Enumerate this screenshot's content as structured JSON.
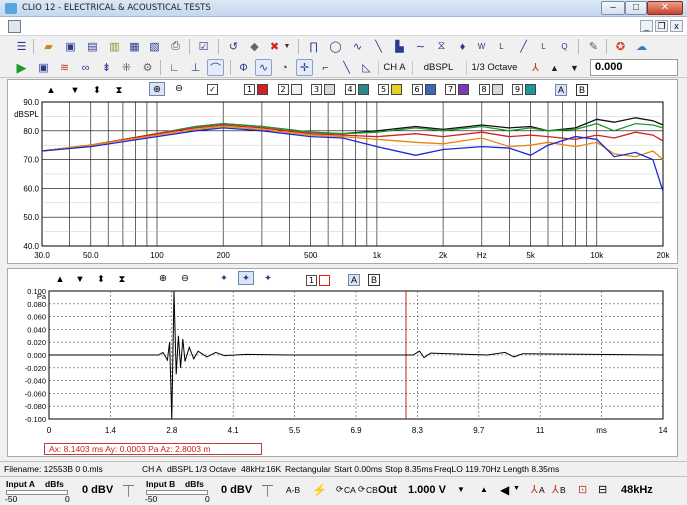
{
  "window": {
    "title": "CLIO 12 - ELECTRICAL & ACOUSTICAL TESTS",
    "controls": {
      "minimize": "–",
      "maximize": "□",
      "close": "✕"
    },
    "mdi_controls": {
      "minimize": "_",
      "restore": "❐",
      "close": "x"
    }
  },
  "toolbar2": {
    "channel": "CH A",
    "unit": "dBSPL",
    "smoothing": "1/3 Octave",
    "value": "0.000"
  },
  "freq_panel": {
    "y_unit": "dBSPL",
    "checkbox_labels": [
      "1",
      "2",
      "3",
      "4",
      "5",
      "6",
      "7",
      "8",
      "9"
    ],
    "ab_labels": [
      "A",
      "B"
    ]
  },
  "time_panel": {
    "y_unit": "Pa",
    "x_unit": "ms",
    "checkbox_labels": [
      "1"
    ],
    "ab_labels": [
      "A",
      "B"
    ],
    "cursor_readout": "Ax: 8.1403 ms   Ay: 0.0003 Pa   Az: 2.8003 m"
  },
  "status": {
    "filename": "Filename: 12553B 0 0.mls",
    "channel": "CH A",
    "unit": "dBSPL",
    "smoothing": "1/3 Octave",
    "rate": "48kHz",
    "size": "16K",
    "window": "Rectangular",
    "start": "Start 0.00ms",
    "stop": "Stop 8.35ms",
    "freqlo": "FreqLO 119.70Hz",
    "length": "Length 8.35ms"
  },
  "bottom": {
    "input_a_label": "Input A",
    "input_b_label": "Input B",
    "dbfs_label": "dBfs",
    "scale_min": "-50",
    "scale_max": "0",
    "input_a_level": "0 dBV",
    "input_b_level": "0 dBV",
    "ab_toggle": "A-B",
    "ca_label": "CA",
    "cb_label": "CB",
    "out_label": "Out",
    "out_level": "1.000 V",
    "a_label": "A",
    "b_label": "B",
    "sample_rate": "48kHz"
  },
  "chart_data": [
    {
      "type": "line",
      "title": "",
      "xlabel": "Hz",
      "ylabel": "dBSPL",
      "xscale": "log",
      "xlim": [
        30,
        20000
      ],
      "ylim": [
        40,
        90
      ],
      "grid": true,
      "x_ticks": [
        "30.0",
        "50.0",
        "100",
        "200",
        "500",
        "1k",
        "2k",
        "Hz",
        "5k",
        "10k",
        "20k"
      ],
      "y_ticks": [
        "90.0",
        "80.0",
        "70.0",
        "60.0",
        "50.0",
        "40.0"
      ],
      "x": [
        30,
        50,
        100,
        150,
        200,
        300,
        500,
        700,
        1000,
        1500,
        2000,
        3000,
        4000,
        5000,
        6000,
        8000,
        10000,
        12000,
        15000,
        18000,
        20000
      ],
      "series": [
        {
          "color": "#111111",
          "values": [
            73,
            75,
            79,
            81.5,
            82.5,
            81.5,
            79.5,
            79,
            80,
            81.5,
            80.5,
            82,
            81,
            81.5,
            80,
            81,
            84,
            83,
            84.5,
            83.5,
            82
          ]
        },
        {
          "color": "#1f9a2a",
          "values": [
            73,
            75,
            79,
            81.5,
            82.5,
            81.5,
            79.5,
            79,
            79.5,
            81,
            80,
            81.5,
            80,
            81,
            80,
            80.5,
            82.5,
            80,
            82.5,
            82,
            81
          ]
        },
        {
          "color": "#d42020",
          "values": [
            73,
            75,
            79,
            81,
            82,
            81,
            79,
            78.5,
            78,
            79,
            78,
            79.5,
            78,
            78.5,
            78,
            77,
            78.5,
            77.5,
            79.5,
            78.5,
            76.5
          ]
        },
        {
          "color": "#e8870f",
          "values": [
            73,
            75,
            78.5,
            80.5,
            81.5,
            80.5,
            78.5,
            78,
            77,
            76,
            75.5,
            77.5,
            74.5,
            75,
            76,
            74.5,
            76,
            72,
            71,
            73,
            70
          ]
        },
        {
          "color": "#1a28d6",
          "values": [
            73,
            74.5,
            78,
            80,
            81,
            80,
            78,
            77.5,
            74.5,
            71.5,
            73.5,
            74.5,
            74,
            71.5,
            75,
            78,
            77,
            71,
            72.5,
            70,
            59
          ]
        }
      ]
    },
    {
      "type": "line",
      "title": "",
      "xlabel": "ms",
      "ylabel": "Pa",
      "xlim": [
        0,
        14
      ],
      "ylim": [
        -0.1,
        0.1
      ],
      "grid": true,
      "x_ticks": [
        "0",
        "1.4",
        "2.8",
        "4.1",
        "5.5",
        "6.9",
        "8.3",
        "9.7",
        "11",
        "ms",
        "14"
      ],
      "y_ticks": [
        "0.100",
        "0.080",
        "0.060",
        "0.040",
        "0.020",
        "0.000",
        "-0.020",
        "-0.040",
        "-0.060",
        "-0.080",
        "-0.100"
      ],
      "cursor_x": 8.1403,
      "series": [
        {
          "color": "#000000",
          "x": [
            0,
            2.5,
            2.6,
            2.7,
            2.75,
            2.8,
            2.85,
            2.9,
            2.95,
            3.0,
            3.05,
            3.1,
            3.2,
            3.3,
            3.4,
            3.6,
            3.8,
            4.0,
            4.5,
            5.5,
            8.3,
            8.45,
            8.55,
            8.7,
            10.0,
            10.4,
            10.6,
            10.8,
            14
          ],
          "values": [
            0,
            0,
            0.004,
            -0.008,
            0.02,
            -0.1,
            0.1,
            -0.03,
            0.03,
            -0.02,
            0.025,
            -0.01,
            0.012,
            -0.006,
            0.006,
            -0.003,
            0.004,
            -0.001,
            0.001,
            0,
            0,
            0.006,
            -0.004,
            0.003,
            0,
            0.004,
            -0.003,
            0.002,
            0
          ]
        }
      ]
    }
  ]
}
